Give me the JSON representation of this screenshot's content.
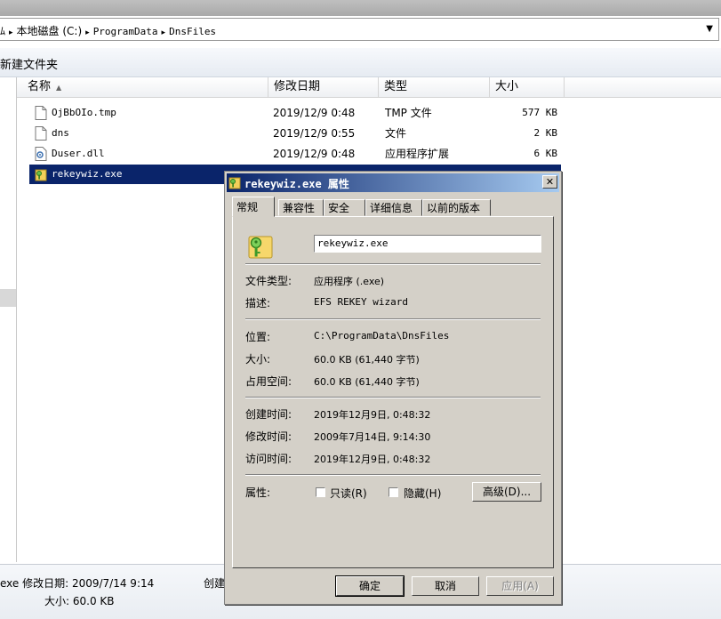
{
  "address": {
    "crumbs": [
      "本地磁盘 (C:)",
      "ProgramData",
      "DnsFiles"
    ],
    "lead_glyph": "ﾑ"
  },
  "toolbar": {
    "new_folder": "新建文件夹"
  },
  "columns": {
    "name": "名称",
    "date": "修改日期",
    "type": "类型",
    "size": "大小"
  },
  "files": [
    {
      "name": "OjBbOIo.tmp",
      "date": "2019/12/9 0:48",
      "type": "TMP 文件",
      "size": "577 KB",
      "icon": "blank-file-icon"
    },
    {
      "name": "dns",
      "date": "2019/12/9 0:55",
      "type": "文件",
      "size": "2 KB",
      "icon": "blank-file-icon"
    },
    {
      "name": "Duser.dll",
      "date": "2019/12/9 0:48",
      "type": "应用程序扩展",
      "size": "6 KB",
      "icon": "dll-file-icon"
    },
    {
      "name": "rekeywiz.exe",
      "date": "",
      "type": "",
      "size": "",
      "icon": "key-folder-icon"
    }
  ],
  "details": {
    "line1": "exe  修改日期: 2009/7/14 9:14",
    "line2": "大小: 60.0 KB",
    "line3": "创建"
  },
  "dialog": {
    "title": "rekeywiz.exe 属性",
    "close": "✕",
    "tabs": [
      "常规",
      "兼容性",
      "安全",
      "详细信息",
      "以前的版本"
    ],
    "filename": "rekeywiz.exe",
    "labels": {
      "file_type": "文件类型:",
      "description": "描述:",
      "location": "位置:",
      "size": "大小:",
      "size_on_disk": "占用空间:",
      "created": "创建时间:",
      "modified": "修改时间:",
      "accessed": "访问时间:",
      "attributes": "属性:"
    },
    "values": {
      "file_type": "应用程序 (.exe)",
      "description": "EFS REKEY wizard",
      "location": "C:\\ProgramData\\DnsFiles",
      "size": "60.0 KB (61,440 字节)",
      "size_on_disk": "60.0 KB (61,440 字节)",
      "created": "2019年12月9日, 0:48:32",
      "modified": "2009年7月14日, 9:14:30",
      "accessed": "2019年12月9日, 0:48:32"
    },
    "readonly_label": "只读(R)",
    "hidden_label": "隐藏(H)",
    "advanced_label": "高级(D)...",
    "ok": "确定",
    "cancel": "取消",
    "apply": "应用(A)"
  },
  "colors": {
    "selection": "#0a246a",
    "dialog_face": "#d4d0c8",
    "titlebar_start": "#0a246a",
    "titlebar_end": "#a6caf0"
  }
}
